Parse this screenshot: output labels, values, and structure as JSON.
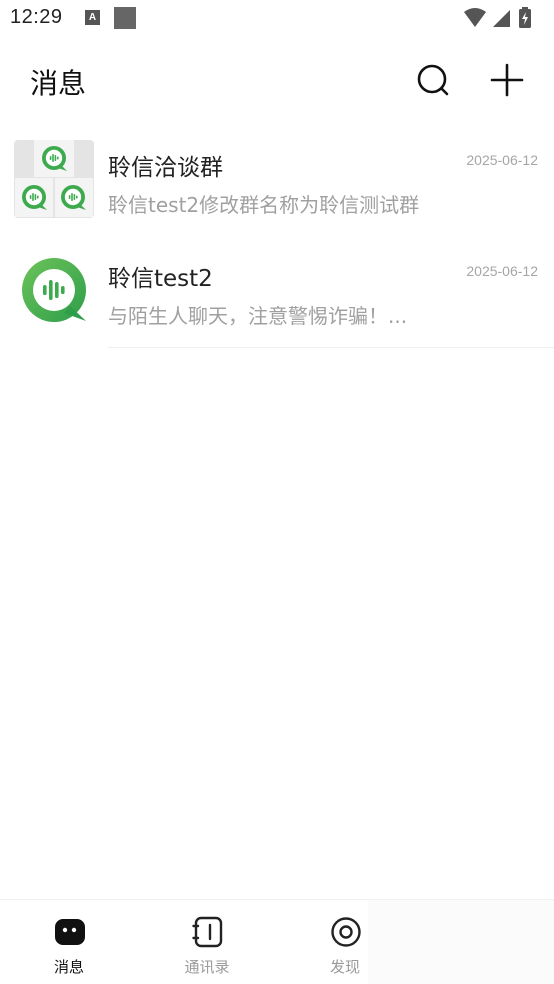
{
  "status_bar": {
    "time": "12:29",
    "notification_letter": "A"
  },
  "header": {
    "title": "消息"
  },
  "conversations": [
    {
      "name": "聆信洽谈群",
      "date": "2025-06-12",
      "preview": "聆信test2修改群名称为聆信测试群",
      "avatar": "group-avatar-icon"
    },
    {
      "name": "聆信test2",
      "date": "2025-06-12",
      "preview": "与陌生人聊天，注意警惕诈骗！...",
      "avatar": "app-logo-icon"
    }
  ],
  "bottom_nav": {
    "items": [
      {
        "label": "消息",
        "icon": "chat-bubble-icon",
        "active": true
      },
      {
        "label": "通讯录",
        "icon": "contacts-book-icon",
        "active": false
      },
      {
        "label": "发现",
        "icon": "discover-target-icon",
        "active": false
      }
    ]
  },
  "colors": {
    "brand_green": "#3DAA4E",
    "brand_green_light": "#6CC35A",
    "muted_text": "#A0A0A0"
  }
}
